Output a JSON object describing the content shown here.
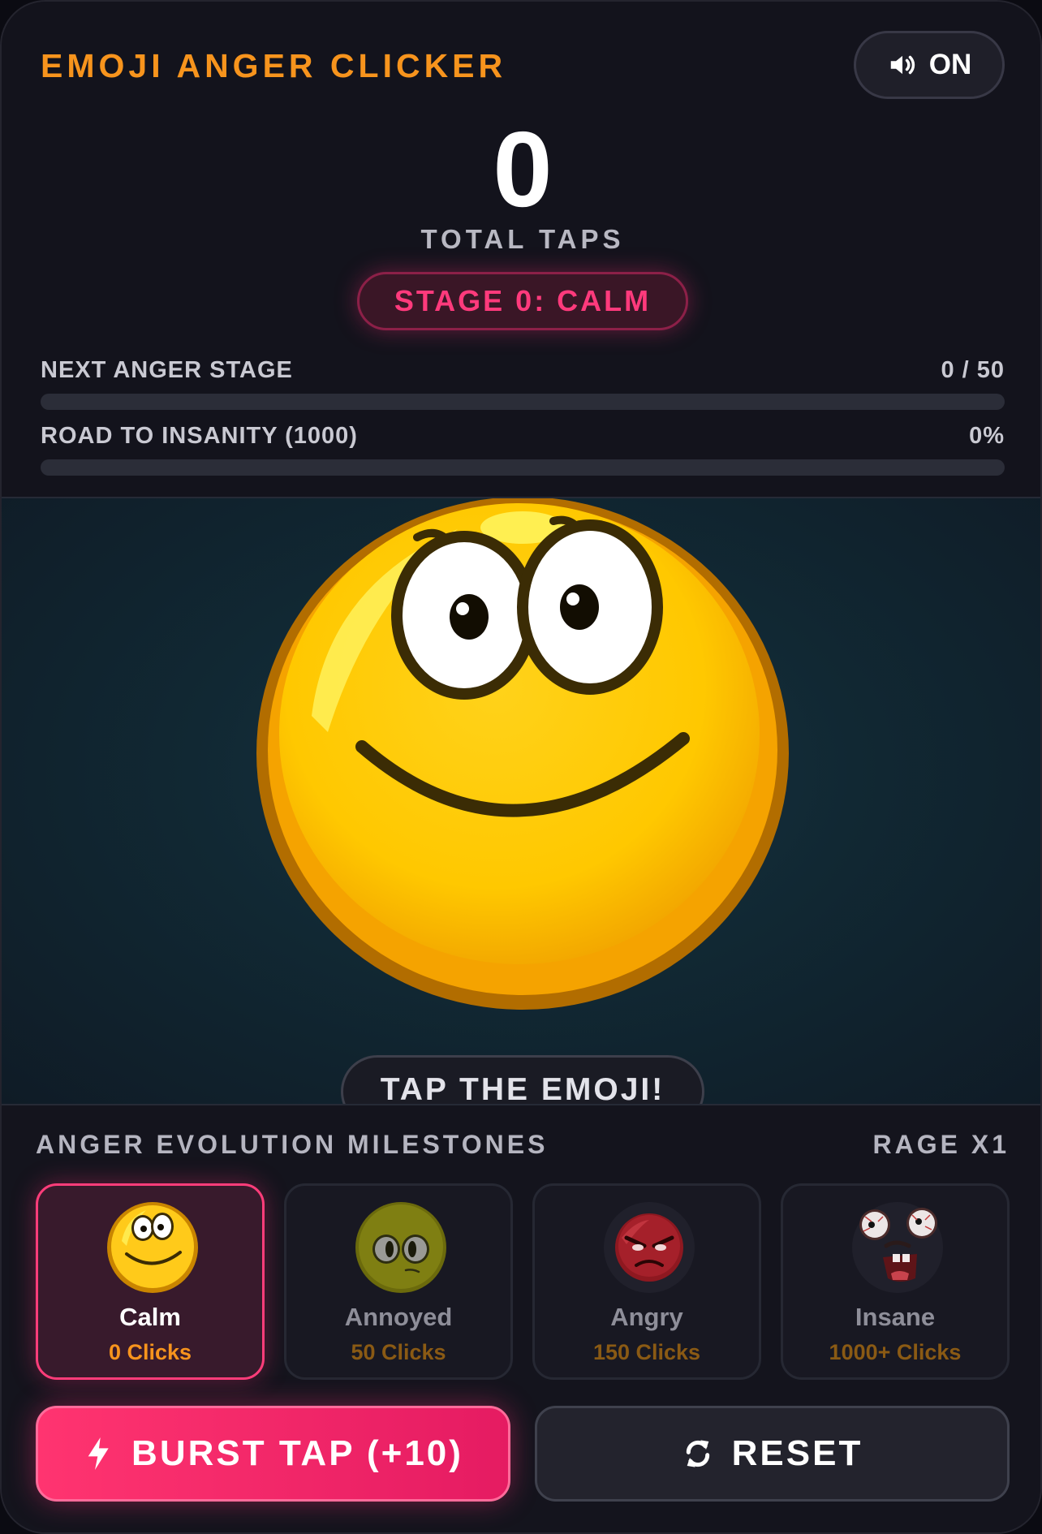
{
  "header": {
    "title": "EMOJI ANGER CLICKER",
    "sound_label": "ON",
    "sound_icon": "speaker-icon"
  },
  "counter": {
    "value": "0",
    "label": "TOTAL TAPS",
    "stage": "STAGE 0: CALM"
  },
  "progress": [
    {
      "label": "NEXT ANGER STAGE",
      "value_text": "0 / 50",
      "fraction": 0
    },
    {
      "label": "ROAD TO INSANITY (1000)",
      "value_text": "0%",
      "fraction": 0
    }
  ],
  "play_area": {
    "hint": "TAP THE EMOJI!",
    "emoji_icon": "calm-emoji-icon"
  },
  "milestones": {
    "title": "ANGER EVOLUTION MILESTONES",
    "rage": "RAGE X1",
    "items": [
      {
        "name": "Calm",
        "clicks": "0 Clicks",
        "icon": "calm-emoji-icon",
        "active": true
      },
      {
        "name": "Annoyed",
        "clicks": "50 Clicks",
        "icon": "annoyed-emoji-icon",
        "active": false
      },
      {
        "name": "Angry",
        "clicks": "150 Clicks",
        "icon": "angry-emoji-icon",
        "active": false
      },
      {
        "name": "Insane",
        "clicks": "1000+ Clicks",
        "icon": "insane-emoji-icon",
        "active": false
      }
    ]
  },
  "actions": {
    "burst_label": "BURST TAP (+10)",
    "burst_icon": "lightning-icon",
    "reset_label": "RESET",
    "reset_icon": "refresh-icon"
  },
  "colors": {
    "accent_orange": "#f7941d",
    "accent_pink": "#ff3a7c",
    "background": "#13131c"
  }
}
